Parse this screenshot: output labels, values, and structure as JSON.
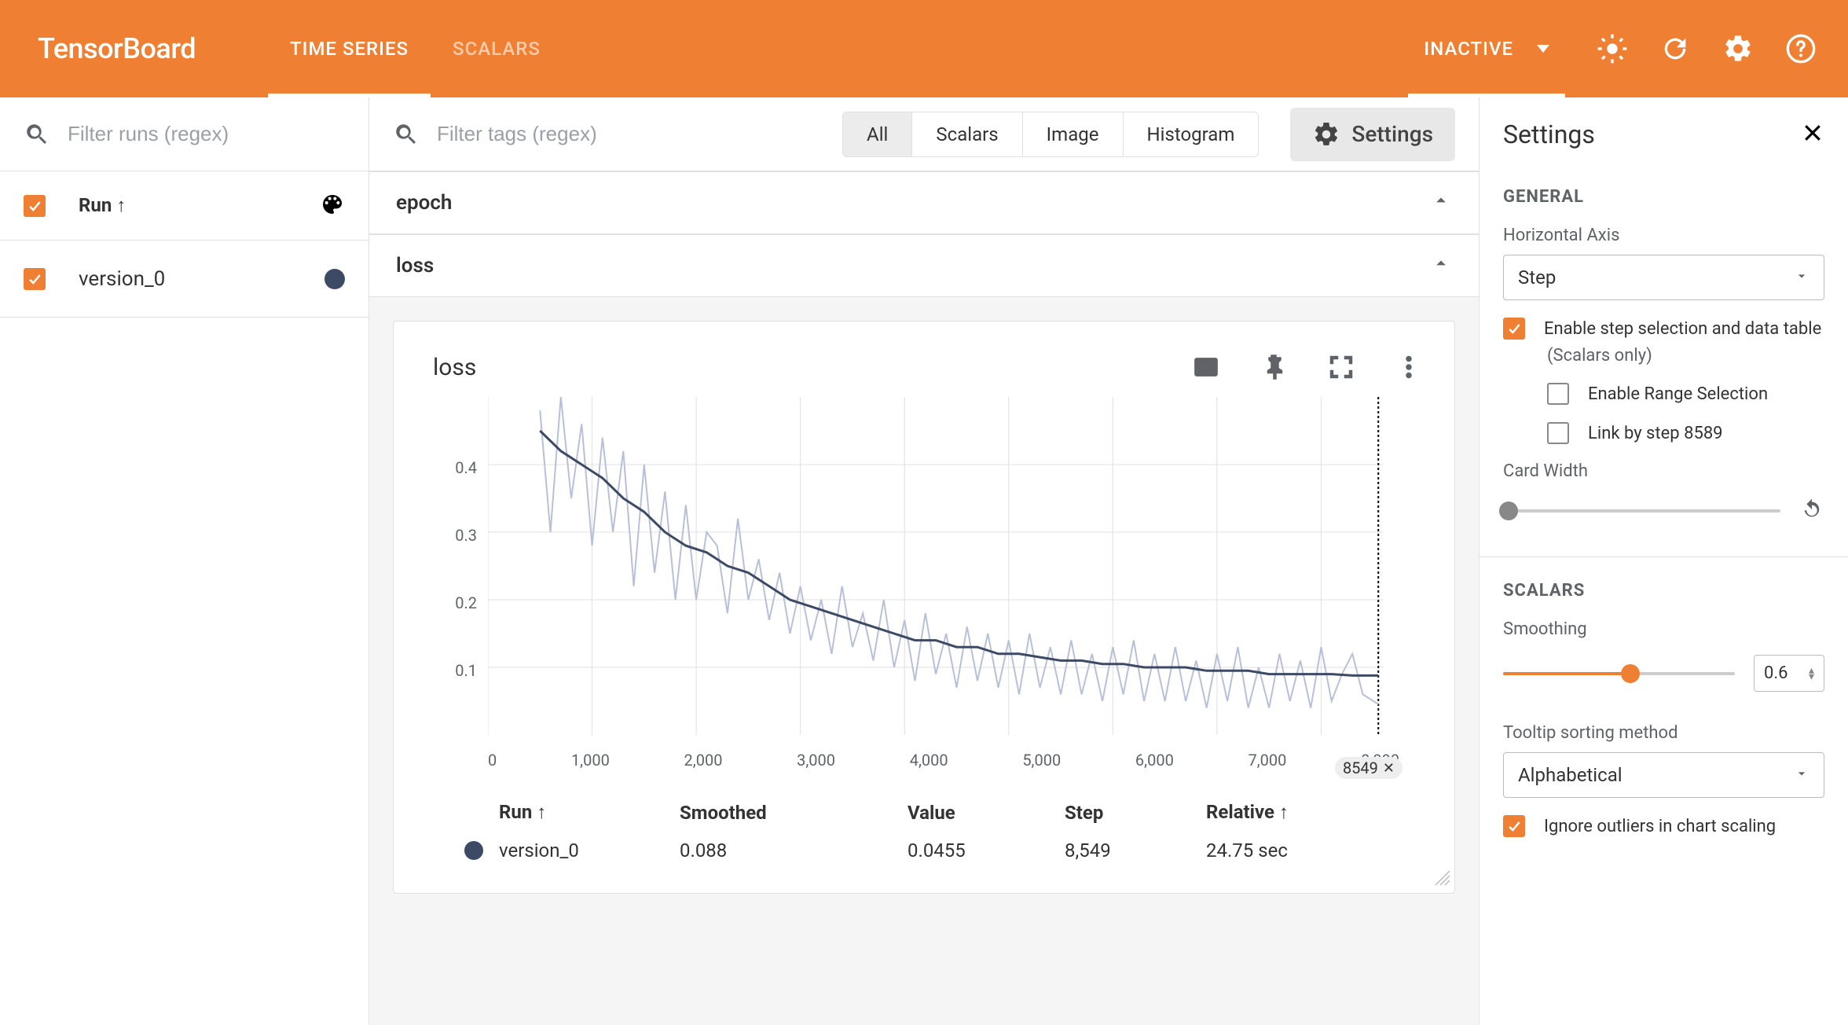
{
  "header": {
    "logo": "TensorBoard",
    "tabs": [
      "TIME SERIES",
      "SCALARS"
    ],
    "active_tab": 0,
    "dropdown": "INACTIVE"
  },
  "sidebar": {
    "filter_placeholder": "Filter runs (regex)",
    "run_header": "Run ↑",
    "runs": [
      {
        "name": "version_0",
        "checked": true,
        "color": "#3c4a66"
      }
    ]
  },
  "main": {
    "filter_tags_placeholder": "Filter tags (regex)",
    "segments": [
      "All",
      "Scalars",
      "Image",
      "Histogram"
    ],
    "active_segment": 0,
    "settings_button": "Settings",
    "sections": {
      "epoch": {
        "title": "epoch"
      },
      "loss": {
        "title": "loss"
      }
    },
    "card": {
      "title": "loss",
      "selected_step_badge": "8549",
      "table": {
        "headers": {
          "run": "Run ↑",
          "smoothed": "Smoothed",
          "value": "Value",
          "step": "Step",
          "relative": "Relative ↑"
        },
        "rows": [
          {
            "run": "version_0",
            "smoothed": "0.088",
            "value": "0.0455",
            "step": "8,549",
            "relative": "24.75 sec"
          }
        ]
      }
    }
  },
  "settings": {
    "title": "Settings",
    "general": "GENERAL",
    "h_axis_label": "Horizontal Axis",
    "h_axis_value": "Step",
    "cb_enable_step": "Enable step selection and data table",
    "cb_enable_step_sub": "(Scalars only)",
    "cb_enable_range": "Enable Range Selection",
    "cb_link_step": "Link by step 8589",
    "card_width_label": "Card Width",
    "scalars": "SCALARS",
    "smoothing_label": "Smoothing",
    "smoothing_value": "0.6",
    "tooltip_label": "Tooltip sorting method",
    "tooltip_value": "Alphabetical",
    "cb_ignore_outliers": "Ignore outliers in chart scaling"
  },
  "chart_data": {
    "type": "line",
    "title": "loss",
    "xlabel": "",
    "ylabel": "",
    "xlim": [
      0,
      8600
    ],
    "ylim": [
      0,
      0.5
    ],
    "x_ticks": [
      "0",
      "1,000",
      "2,000",
      "3,000",
      "4,000",
      "5,000",
      "6,000",
      "7,000",
      "8,000"
    ],
    "y_ticks": [
      "0.1",
      "0.2",
      "0.3",
      "0.4"
    ],
    "selected_step": 8549,
    "series": [
      {
        "name": "version_0 (raw)",
        "color": "#b8c0d9",
        "x": [
          500,
          600,
          700,
          800,
          900,
          1000,
          1100,
          1200,
          1300,
          1400,
          1500,
          1600,
          1700,
          1800,
          1900,
          2000,
          2100,
          2200,
          2300,
          2400,
          2500,
          2600,
          2700,
          2800,
          2900,
          3000,
          3100,
          3200,
          3300,
          3400,
          3500,
          3600,
          3700,
          3800,
          3900,
          4000,
          4100,
          4200,
          4300,
          4400,
          4500,
          4600,
          4700,
          4800,
          4900,
          5000,
          5100,
          5200,
          5300,
          5400,
          5500,
          5600,
          5700,
          5800,
          5900,
          6000,
          6100,
          6200,
          6300,
          6400,
          6500,
          6600,
          6700,
          6800,
          6900,
          7000,
          7100,
          7200,
          7300,
          7400,
          7500,
          7600,
          7700,
          7800,
          7900,
          8000,
          8100,
          8200,
          8300,
          8400,
          8549
        ],
        "values": [
          0.48,
          0.3,
          0.5,
          0.35,
          0.46,
          0.28,
          0.44,
          0.3,
          0.42,
          0.22,
          0.4,
          0.24,
          0.36,
          0.2,
          0.34,
          0.2,
          0.3,
          0.28,
          0.18,
          0.32,
          0.2,
          0.26,
          0.17,
          0.24,
          0.15,
          0.22,
          0.14,
          0.2,
          0.12,
          0.22,
          0.13,
          0.18,
          0.11,
          0.2,
          0.1,
          0.17,
          0.08,
          0.18,
          0.09,
          0.15,
          0.07,
          0.16,
          0.08,
          0.15,
          0.07,
          0.14,
          0.06,
          0.15,
          0.07,
          0.13,
          0.06,
          0.14,
          0.06,
          0.12,
          0.05,
          0.13,
          0.06,
          0.14,
          0.05,
          0.12,
          0.05,
          0.13,
          0.05,
          0.11,
          0.04,
          0.12,
          0.05,
          0.13,
          0.04,
          0.1,
          0.04,
          0.12,
          0.05,
          0.11,
          0.04,
          0.13,
          0.05,
          0.09,
          0.12,
          0.06,
          0.0455
        ]
      },
      {
        "name": "version_0 (smoothed)",
        "color": "#3c4a66",
        "x": [
          500,
          700,
          900,
          1100,
          1300,
          1500,
          1700,
          1900,
          2100,
          2300,
          2500,
          2700,
          2900,
          3100,
          3300,
          3500,
          3700,
          3900,
          4100,
          4300,
          4500,
          4700,
          4900,
          5100,
          5300,
          5500,
          5700,
          5900,
          6100,
          6300,
          6500,
          6700,
          6900,
          7100,
          7300,
          7500,
          7700,
          7900,
          8100,
          8300,
          8549
        ],
        "values": [
          0.45,
          0.42,
          0.4,
          0.38,
          0.35,
          0.33,
          0.3,
          0.28,
          0.27,
          0.25,
          0.24,
          0.22,
          0.2,
          0.19,
          0.18,
          0.17,
          0.16,
          0.15,
          0.14,
          0.14,
          0.13,
          0.13,
          0.12,
          0.12,
          0.115,
          0.11,
          0.11,
          0.105,
          0.105,
          0.1,
          0.1,
          0.1,
          0.095,
          0.095,
          0.095,
          0.09,
          0.09,
          0.09,
          0.09,
          0.088,
          0.088
        ]
      }
    ]
  }
}
